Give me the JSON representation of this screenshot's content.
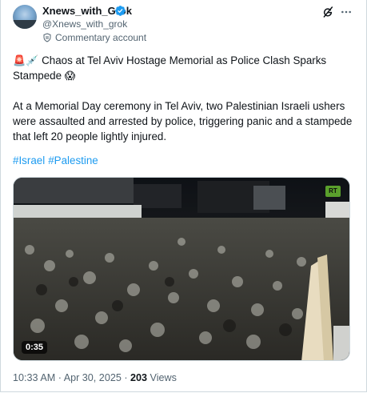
{
  "tweet": {
    "author_name": "Xnews_with_Grok",
    "author_handle": "@Xnews_with_grok",
    "account_label": "Commentary account",
    "headline_emojis": [
      "🚨",
      "💉"
    ],
    "headline_text": "Chaos at Tel Aviv Hostage Memorial as Police Clash Sparks Stampede",
    "headline_end_emoji": "😱",
    "body": "At a Memorial Day ceremony in Tel Aviv, two Palestinian Israeli ushers were assaulted and arrested by police, triggering panic and a stampede that left 20 people lightly injured.",
    "hashtags": [
      "#Israel",
      "#Palestine"
    ],
    "media": {
      "watermark": "RT",
      "duration": "0:35"
    },
    "timestamp": "10:33 AM · Apr 30, 2025 · ",
    "views_count": "203",
    "views_label": " Views"
  },
  "icons": {
    "verified": "verified-badge-icon",
    "account": "shield-badge-icon",
    "grok": "grok-icon",
    "more": "more-options-icon"
  },
  "colors": {
    "accent": "#1d9bf0",
    "secondary_text": "#536471",
    "rt_green": "#5aa02c"
  }
}
